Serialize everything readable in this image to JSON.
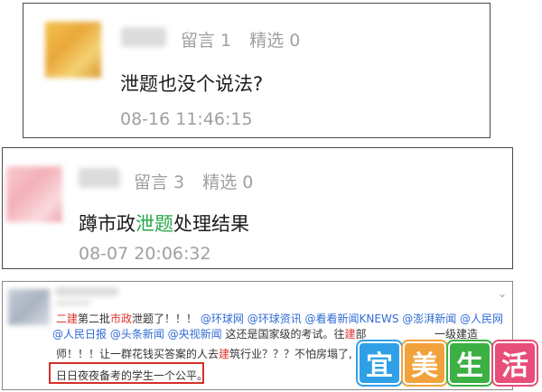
{
  "comments": [
    {
      "reply_label": "留言 1",
      "featured_label": "精选 0",
      "text": "泄题也没个说法?",
      "time": "08-16 11:46:15"
    },
    {
      "reply_label": "留言 3",
      "featured_label": "精选 0",
      "text_before": "蹲市政",
      "text_highlight": "泄题",
      "text_after": "处理结果",
      "time": "08-07 20:06:32"
    }
  ],
  "weibo_post": {
    "line1": {
      "p1": "二建",
      "p2": "第二批",
      "p3": "市政",
      "p4": "泄题了！！！",
      "mentions": "@环球网 @环球资讯 @看看新闻KNEWS @澎湃新闻 @人民网"
    },
    "line2": {
      "mentions": "@人民日报 @头条新闻 @央视新闻",
      "text": " 这还是国家级的考试。往",
      "red": "建",
      "tail": "部",
      "right": "一级建造"
    },
    "line3": {
      "p1": "师！！！让一群花钱买答案的人去",
      "red": "建",
      "p2": "筑行业？？？不怕房塌了,"
    },
    "line4": "日日夜夜备考的学生一个公平。"
  },
  "watermark": {
    "chars": [
      "宜",
      "美",
      "生",
      "活"
    ]
  }
}
